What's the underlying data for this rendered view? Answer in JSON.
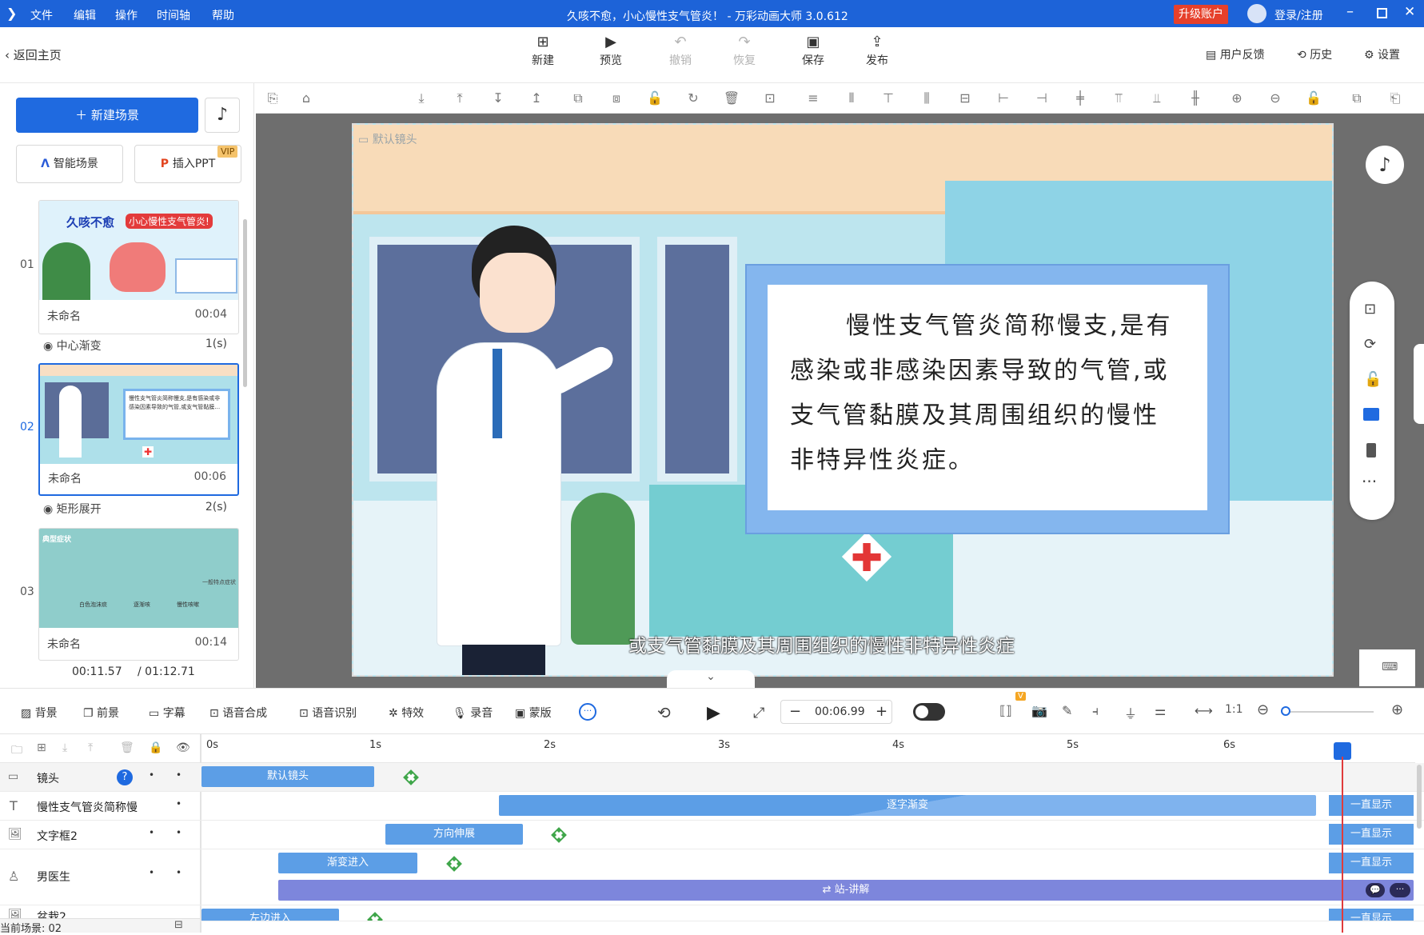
{
  "titlebar": {
    "menu": [
      "文件",
      "编辑",
      "操作",
      "时间轴",
      "帮助"
    ],
    "title": "久咳不愈，小心慢性支气管炎！ - 万彩动画大师 3.0.612",
    "upgrade": "升级账户",
    "login": "登录/注册"
  },
  "toolbar": {
    "back": "返回主页",
    "new": "新建",
    "preview": "预览",
    "undo": "撤销",
    "redo": "恢复",
    "save": "保存",
    "publish": "发布",
    "feedback": "用户反馈",
    "history": "历史",
    "settings": "设置"
  },
  "left": {
    "new_scene": "新建场景",
    "smart_scene": "智能场景",
    "insert_ppt": "插入PPT",
    "vip": "VIP",
    "scenes": [
      {
        "num": "01",
        "name": "未命名",
        "dur": "00:04",
        "trans": "中心渐变",
        "trans_dur": "1(s)"
      },
      {
        "num": "02",
        "name": "未命名",
        "dur": "00:06",
        "trans": "矩形展开",
        "trans_dur": "2(s)"
      },
      {
        "num": "03",
        "name": "未命名",
        "dur": "00:14"
      }
    ],
    "thumb1_title_a": "久咳不愈",
    "thumb1_title_b": "小心慢性支气管炎!",
    "thumb2_text": "慢性支气管炎简称慢支,是有感染或非感染因素导致的气管,或支气管黏膜…",
    "thumb3_title": "典型症状",
    "thumb3_side": "一般特点症状",
    "thumb3_labels": [
      "白色泡沫痰",
      "逐渐咳",
      "慢性咳嗽"
    ],
    "time_current": "00:11.57",
    "time_total": "/ 01:12.71"
  },
  "stage": {
    "camera_label": "默认镜头",
    "board_text": "慢性支气管炎简称慢支,是有感染或非感染因素导致的气管,或支气管黏膜及其周围组织的慢性非特异性炎症。",
    "subtitle": "或支气管黏膜及其周围组织的慢性非特异性炎症"
  },
  "bottom_tools": {
    "bg": "背景",
    "fg": "前景",
    "caption": "字幕",
    "tts": "语音合成",
    "asr": "语音识别",
    "fx": "特效",
    "record": "录音",
    "mask": "蒙版",
    "time": "00:06.99",
    "v_badge": "V"
  },
  "timeline": {
    "ruler": [
      "0s",
      "1s",
      "2s",
      "3s",
      "4s",
      "5s",
      "6s"
    ],
    "rows": [
      {
        "label": "镜头",
        "bar": "默认镜头"
      },
      {
        "label": "慢性支气管炎简称慢",
        "bar": "逐字渐变",
        "end": "一直显示"
      },
      {
        "label": "文字框2",
        "bar": "方向伸展",
        "end": "一直显示"
      },
      {
        "label": "男医生",
        "bar": "渐变进入",
        "end": "一直显示",
        "bar2": "站-讲解"
      },
      {
        "label": "盆栽2",
        "bar": "左边进入",
        "end": "一直显示"
      }
    ],
    "status": "当前场景: 02"
  }
}
